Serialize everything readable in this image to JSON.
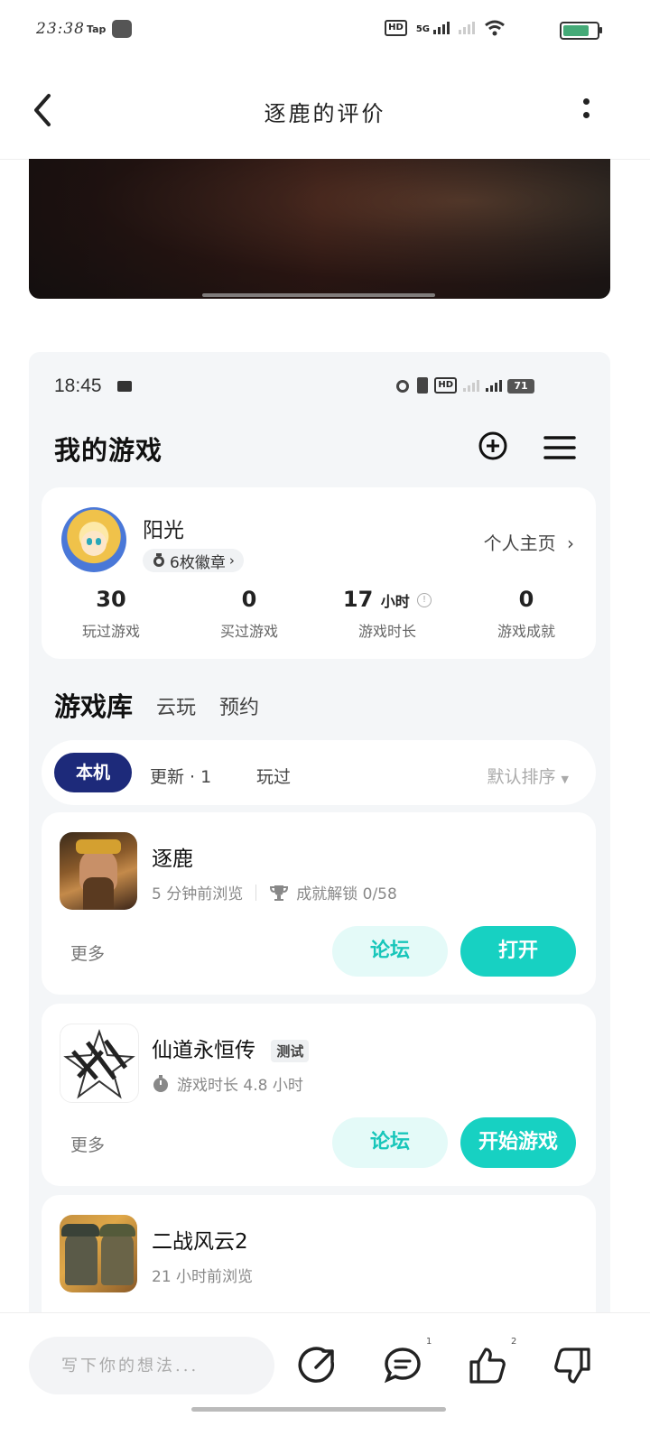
{
  "status_bar": {
    "time": "23:38",
    "tap_label": "Tap",
    "network": "5G",
    "hd_label": "HD"
  },
  "header": {
    "title": "逐鹿的评价"
  },
  "embedded": {
    "status_time": "18:45",
    "battery": "71",
    "page_title": "我的游戏",
    "profile": {
      "name": "阳光",
      "badges": "6枚徽章",
      "homepage_link": "个人主页"
    },
    "stats": [
      {
        "value": "30",
        "unit": "",
        "label": "玩过游戏"
      },
      {
        "value": "0",
        "unit": "",
        "label": "买过游戏"
      },
      {
        "value": "17",
        "unit": "小时",
        "label": "游戏时长"
      },
      {
        "value": "0",
        "unit": "",
        "label": "游戏成就"
      }
    ],
    "library_tabs": [
      "游戏库",
      "云玩",
      "预约"
    ],
    "filters": {
      "active": "本机",
      "update": "更新 · 1",
      "played": "玩过",
      "sort": "默认排序"
    },
    "games": [
      {
        "name": "逐鹿",
        "meta1": "5 分钟前浏览",
        "meta2": "成就解锁 0/58",
        "more": "更多",
        "forum": "论坛",
        "action": "打开"
      },
      {
        "name": "仙道永恒传",
        "tag": "测试",
        "meta1": "游戏时长 4.8 小时",
        "more": "更多",
        "forum": "论坛",
        "action": "开始游戏"
      },
      {
        "name": "二战风云2",
        "meta1": "21 小时前浏览"
      }
    ]
  },
  "bottom_bar": {
    "comment_placeholder": "写下你的想法...",
    "comment_count": "1",
    "like_count": "2"
  }
}
